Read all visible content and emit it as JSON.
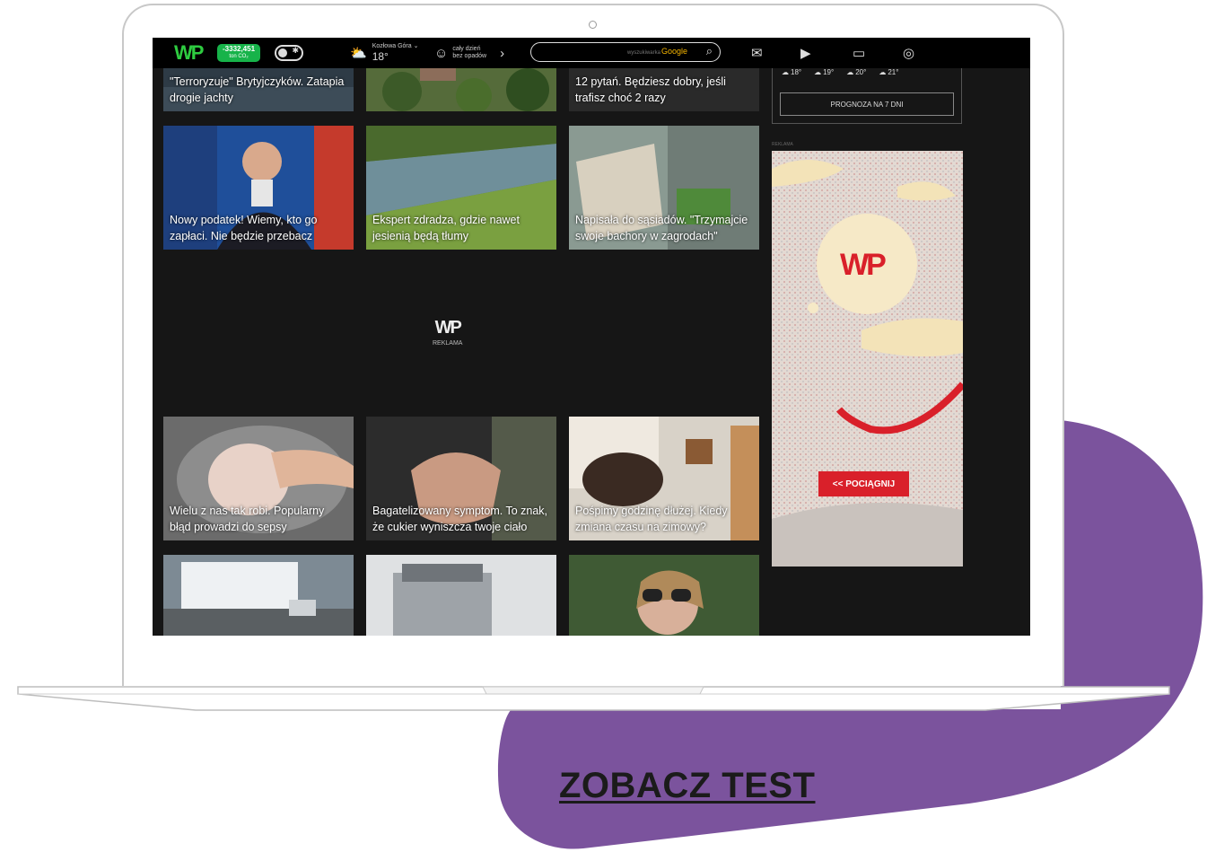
{
  "topbar": {
    "co2_value": "-3332,451",
    "co2_unit": "ton CO₂",
    "location": "Kozłowa Góra ⌄",
    "temperature": "18°",
    "forecast_line1": "cały dzień",
    "forecast_line2": "bez opadów",
    "search_brand_prefix": "wyszukiwarka",
    "search_brand": "Google"
  },
  "tiles": [
    {
      "caption": "\"Terroryzuje\" Brytyjczyków. Zatapia drogie jachty"
    },
    {
      "caption": ""
    },
    {
      "caption": "12 pytań. Będziesz dobry, jeśli trafisz choć 2 razy"
    },
    {
      "caption": "Nowy podatek! Wiemy, kto go zapłaci. Nie będzie przebacz"
    },
    {
      "caption": "Ekspert zdradza, gdzie nawet jesienią będą tłumy"
    },
    {
      "caption": "Napisała do sąsiadów. \"Trzymajcie swoje bachory w zagrodach\""
    },
    {
      "caption": "Wielu z nas tak robi. Popularny błąd prowadzi do sepsy"
    },
    {
      "caption": "Bagatelizowany symptom. To znak, że cukier wyniszcza twoje ciało"
    },
    {
      "caption": "Pośpimy godzinę dłużej. Kiedy zmiana czasu na zimowy?"
    }
  ],
  "ad_center": {
    "logo": "WP",
    "label": "REKLAMA"
  },
  "weather_panel": {
    "hours": [
      {
        "temp": "18°"
      },
      {
        "temp": "19°"
      },
      {
        "temp": "20°"
      },
      {
        "temp": "21°"
      }
    ],
    "forecast_button": "PROGNOZA NA 7 DNI"
  },
  "right_ad": {
    "label": "REKLAMA",
    "button": "<< POCIĄGNIJ",
    "logo": "WP"
  },
  "cta": {
    "label": "ZOBACZ TEST"
  },
  "colors": {
    "purple": "#7b539d",
    "wp_green": "#2ecc40",
    "ad_red": "#d9202a"
  }
}
